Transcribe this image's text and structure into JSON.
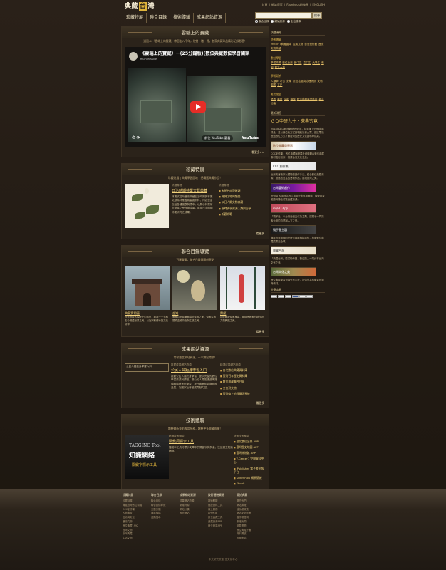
{
  "header": {
    "logo_left": "典藏",
    "logo_box": "台",
    "logo_right": "灣",
    "toplinks": [
      "首頁",
      "|",
      "網站導覽",
      "|",
      "Facebook粉絲團",
      "|",
      "ENGLISH"
    ],
    "nav": [
      "珍藏特展",
      "聯合目錄",
      "技術體驗",
      "成果網站資源"
    ],
    "search_placeholder": "",
    "search_button": "搜尋",
    "radios": [
      "聯合目錄",
      "網站資源",
      "全站搜尋"
    ]
  },
  "video_section": {
    "title": "雲端上的寶藏",
    "subtitle": "透過4K『雲端上的寶藏』帶您走入千年，欣賞一睹一覽，各家典藏珍品精彩紀錄影音！",
    "video_title": "《雲端上的寶藏》－(25分鐘版)(數位典藏數位學習國家",
    "video_sub": "mOnlineAtlas",
    "watch_label": "前往 YouTube 觀看",
    "brand": "YouTube",
    "more": "看更多>>"
  },
  "feature_section": {
    "title": "珍藏特展",
    "subtitle": "珍藏特展 | 典藏學習園地・把精選典藏作品！",
    "left_label": "精選專題",
    "item_title": "日治時期林業文獻典藏",
    "item_desc": "林業試驗所歷史典藏日治時期的林業文獻為林業發展重要資料，內容豐富包括各種圖表與標本，以展示林業研究發展之歷程與成果，展現日治時期林業研究之成果。",
    "right_label": "精選專題",
    "list": [
      "宋明台南藝術類",
      "寶寶之地的類美",
      "以日人類文物典藏",
      "現時表現資源入類與分享",
      "新觀規範"
    ],
    "more": "看更多"
  },
  "catalog_section": {
    "title": "聯合目錄導覽",
    "subtitle": "百匯豐宴，聯合目錄寶藏新亮點",
    "items": [
      {
        "title": "典藏寶門蒐",
        "desc": "台灣寶藏各類歷史的城門，看盡一千多種古今寶藏世界之美，以及宗教傳承與文化精神。"
      },
      {
        "title": "金雉",
        "desc": "畫家以細膩筆觸描繪金雉之美，優雅姿態展現金雉特色與生態之美。"
      },
      {
        "title": "舞姬",
        "desc": "描繪舞姬優雅身姿，展現藝術家的創作功力與舞蹈之美。"
      }
    ],
    "more": "看更多"
  },
  "result_section": {
    "title": "成果網站資源",
    "subtitle": "常保豐富網站資源，一本讀出閱讀！",
    "pic_alt": "公民人員鉅身學習入口",
    "left_label": "推薦成果網站資源",
    "item_title": "公民人員鉅身學習入口",
    "item_desc": "推動公民人員終身學習，提供完整的數位學習資源與課程，讓公民人員能透過網路隨時隨地進行學習，提升專業知能與服務品質，為國家社會發展貢獻力量。",
    "right_label": "精選成果網站資源",
    "list": [
      "台北數位典藏資料庫",
      "臺灣百年歷史資料庫",
      "數位典藏聯合目錄",
      "全台灣文物",
      "臺灣線上地理資訊系統"
    ],
    "more": "看更多"
  },
  "tech_section": {
    "title": "技術體驗",
    "subtitle": "體驗最新技術應用服務，體驗更多典藏成果！",
    "pic_t1": "TAGGING Tool",
    "pic_t2": "知識網絡",
    "pic_t3": "關鍵字標示工具",
    "left_label": "精選技術體驗",
    "item_title": "關鍵詞標示工具",
    "item_desc": "體驗本工具可標示文章中的關鍵字與詞彙，快速建立知識網絡。",
    "right_label": "精選技術體驗",
    "list": [
      "臺北數位全景 APP",
      "臺灣歷史地圖 APP",
      "臺灣博物館 APP",
      "Y-Center：空間資料中心",
      "iPublisher 電子書出版平台",
      "SlideShow 網頁簡報",
      "Ebook"
    ],
    "more": "看更多"
  },
  "sidebar": {
    "head1": "快速連結",
    "groups": [
      {
        "title": "藝術典藏",
        "links": [
          "MOTIFIT典藏圖庫",
          "金屬文物",
          "台灣美術館",
          "歷史文物典藏"
        ]
      },
      {
        "title": "數位學習",
        "links": [
          "學習資源",
          "數位台灣",
          "國中生",
          "高中生",
          "大專生",
          "教師",
          "研究人員"
        ]
      },
      {
        "title": "學術研究",
        "links": [
          "人類學",
          "考古",
          "史學",
          "數位地圖與地理資訊",
          "文物",
          "圖書",
          "文史"
        ]
      },
      {
        "title": "應用加值",
        "links": [
          "藝術",
          "影音",
          "文創",
          "圖像",
          "數位典藏產業應用",
          "創意加值"
        ]
      }
    ],
    "head2": "最新消息",
    "banner": "ＧＯ中研九十・來典究竟",
    "texts": [
      "2018年為中研院創院90週年，特選擇了90個典藏精品，並以數位化方式呈現給社會大眾，讓民眾能透過數位方式了解台灣的歷史文化與科學成果。",
      "CCC創作集：數位典藏與學習計畫鼓勵以數位典藏素材進行創作，推廣台灣文化之美。",
      "台灣的藝術家以獨特的創作手法，結合數位典藏資源，創造出豐富的藝術作品，展現台灣之美。",
      "myBD App提供數位典藏行動應用服務，讓使用者能隨時隨地瀏覽典藏資源。",
      "「親子島」以台灣島嶼文化為主題，讓親子一同探索台灣的自然與人文之美。",
      "典藏台灣與國內外數位典藏機構合作，推廣數位典藏成果至全球。",
      "「典藏台灣」臉書粉絲團，歡迎加入一同分享台灣文化之美。",
      "數位典藏學習資源分享平台，提供豐富的學習資源與教材。"
    ],
    "ads": [
      "數位典藏與學習",
      "CCC 創作集",
      "台灣藝術創作",
      "myBD App",
      "親子島主題",
      "典藏台灣",
      "台灣文化之美"
    ],
    "head3": "分享本頁"
  },
  "footer": {
    "columns": [
      {
        "head": "珍藏特展",
        "items": [
          "珍藏特展",
          "典藏台灣數位特展",
          "CCC創作集",
          "人物典藏",
          "藝術與文化",
          "歷史文物",
          "數位典藏1992",
          "台灣文物",
          "臺灣典藏",
          "生活文物"
        ]
      },
      {
        "head": "聯合目錄",
        "items": [
          "聯合目錄",
          "聯合目錄導覽",
          "主題分類",
          "典藏機構",
          "進階搜尋"
        ]
      },
      {
        "head": "成果網站資源",
        "items": [
          "成果網站資源",
          "新增資源",
          "網站分類",
          "推薦網站"
        ]
      },
      {
        "head": "技術體驗資源",
        "items": [
          "技術體驗",
          "開放資料工具",
          "線上服務",
          "APP應用",
          "數位典藏工具",
          "典藏資源APP",
          "數位學習APP"
        ]
      },
      {
        "head": "關於典藏",
        "items": [
          "關於我們",
          "網站導覽",
          "隱私權政策",
          "網站安全政策",
          "著作權聲明",
          "聯絡我們",
          "常見問題",
          "數位典藏計畫",
          "資料開放",
          "相關連結"
        ]
      }
    ],
    "copyright": "中央研究院 數位文化中心"
  }
}
